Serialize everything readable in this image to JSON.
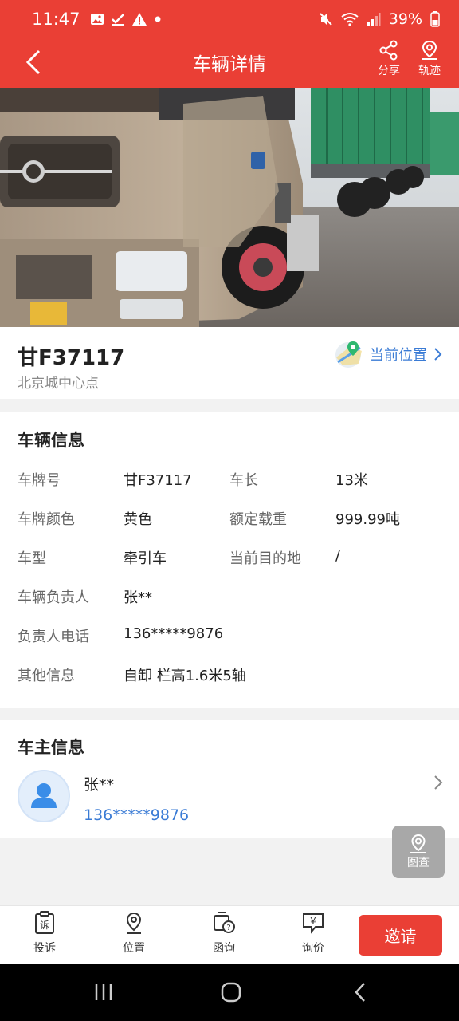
{
  "status_bar": {
    "time": "11:47",
    "battery": "39%",
    "left_icons": [
      "image-icon",
      "check-icon",
      "warning-icon",
      "dot-icon"
    ],
    "right_icons": [
      "mute-icon",
      "wifi-icon",
      "signal-icon",
      "battery-icon"
    ]
  },
  "header": {
    "title": "车辆详情",
    "share_label": "分享",
    "track_label": "轨迹"
  },
  "vehicle": {
    "plate": "甘F37117",
    "location": "北京城中心点",
    "current_position_label": "当前位置"
  },
  "vehicle_info": {
    "title": "车辆信息",
    "rows": [
      {
        "label": "车牌号",
        "value": "甘F37117",
        "label2": "车长",
        "value2": "13米"
      },
      {
        "label": "车牌颜色",
        "value": "黄色",
        "label2": "额定载重",
        "value2": "999.99吨"
      },
      {
        "label": "车型",
        "value": "牵引车",
        "label2": "当前目的地",
        "value2": "/"
      },
      {
        "label": "车辆负责人",
        "value": "张**"
      },
      {
        "label": "负责人电话",
        "value": "136*****9876"
      },
      {
        "label": "其他信息",
        "value": "自卸 栏高1.6米5轴"
      }
    ]
  },
  "owner_info": {
    "title": "车主信息",
    "name": "张**",
    "phone": "136*****9876"
  },
  "float_button": {
    "label": "图查"
  },
  "bottom_bar": {
    "complaint": "投诉",
    "location": "位置",
    "inquiry_letter": "函询",
    "price_inquiry": "询价",
    "invite": "邀请"
  },
  "colors": {
    "brand": "#ea3f35",
    "link": "#3a7bd5"
  }
}
